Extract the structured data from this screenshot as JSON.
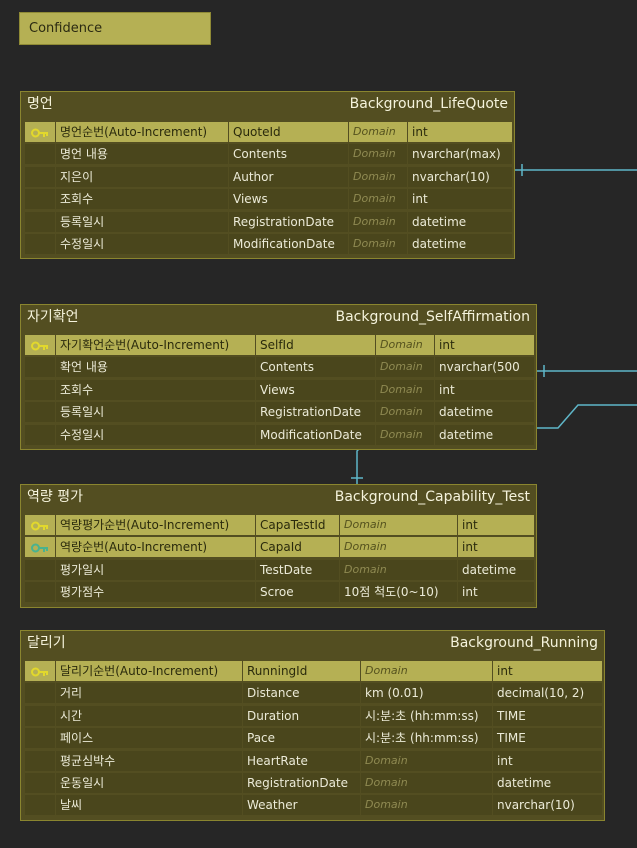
{
  "badge": {
    "label": "Confidence"
  },
  "icons": {
    "primary_key": "key-icon",
    "foreign_key": "foreign-key-icon"
  },
  "colors": {
    "entity_bg": "#534e21",
    "pk_row": "#b5b054",
    "line": "#5fb6c8",
    "fk_key": "#49b28f",
    "pk_key": "#e2d82c"
  },
  "entities": [
    {
      "name": "명언",
      "table": "Background_LifeQuote",
      "rows": [
        {
          "key": "pk",
          "logical": "명언순번(Auto-Increment)",
          "physical": "QuoteId",
          "domain": "Domain",
          "type": "int"
        },
        {
          "key": "",
          "logical": "명언 내용",
          "physical": "Contents",
          "domain": "Domain",
          "type": "nvarchar(max)"
        },
        {
          "key": "",
          "logical": "지은이",
          "physical": "Author",
          "domain": "Domain",
          "type": "nvarchar(10)"
        },
        {
          "key": "",
          "logical": "조회수",
          "physical": "Views",
          "domain": "Domain",
          "type": "int"
        },
        {
          "key": "",
          "logical": "등록일시",
          "physical": "RegistrationDate",
          "domain": "Domain",
          "type": "datetime"
        },
        {
          "key": "",
          "logical": "수정일시",
          "physical": "ModificationDate",
          "domain": "Domain",
          "type": "datetime"
        }
      ]
    },
    {
      "name": "자기확언",
      "table": "Background_SelfAffirmation",
      "rows": [
        {
          "key": "pk",
          "logical": "자기확언순번(Auto-Increment)",
          "physical": "SelfId",
          "domain": "Domain",
          "type": "int"
        },
        {
          "key": "",
          "logical": "확언 내용",
          "physical": "Contents",
          "domain": "Domain",
          "type": "nvarchar(500"
        },
        {
          "key": "",
          "logical": "조회수",
          "physical": "Views",
          "domain": "Domain",
          "type": "int"
        },
        {
          "key": "",
          "logical": "등록일시",
          "physical": "RegistrationDate",
          "domain": "Domain",
          "type": "datetime"
        },
        {
          "key": "",
          "logical": "수정일시",
          "physical": "ModificationDate",
          "domain": "Domain",
          "type": "datetime"
        }
      ]
    },
    {
      "name": "역량 평가",
      "table": "Background_Capability_Test",
      "rows": [
        {
          "key": "pk",
          "logical": "역량평가순번(Auto-Increment)",
          "physical": "CapaTestId",
          "domain": "Domain",
          "type": "int"
        },
        {
          "key": "fk",
          "logical": "역량순번(Auto-Increment)",
          "physical": "CapaId",
          "domain": "Domain",
          "type": "int"
        },
        {
          "key": "",
          "logical": "평가일시",
          "physical": "TestDate",
          "domain": "Domain",
          "type": "datetime"
        },
        {
          "key": "",
          "logical": "평가점수",
          "physical": "Scroe",
          "domain": "10점 척도(0~10)",
          "type": "int"
        }
      ]
    },
    {
      "name": "달리기",
      "table": "Background_Running",
      "rows": [
        {
          "key": "pk",
          "logical": "달리기순번(Auto-Increment)",
          "physical": "RunningId",
          "domain": "Domain",
          "type": "int"
        },
        {
          "key": "",
          "logical": "거리",
          "physical": "Distance",
          "domain": "km (0.01)",
          "type": "decimal(10, 2)"
        },
        {
          "key": "",
          "logical": "시간",
          "physical": "Duration",
          "domain": "시:분:초 (hh:mm:ss)",
          "type": "TIME"
        },
        {
          "key": "",
          "logical": "페이스",
          "physical": "Pace",
          "domain": "시:분:초 (hh:mm:ss)",
          "type": "TIME"
        },
        {
          "key": "",
          "logical": "평균심박수",
          "physical": "HeartRate",
          "domain": "Domain",
          "type": "int"
        },
        {
          "key": "",
          "logical": "운동일시",
          "physical": "RegistrationDate",
          "domain": "Domain",
          "type": "datetime"
        },
        {
          "key": "",
          "logical": "날씨",
          "physical": "Weather",
          "domain": "Domain",
          "type": "nvarchar(10)"
        }
      ]
    }
  ]
}
